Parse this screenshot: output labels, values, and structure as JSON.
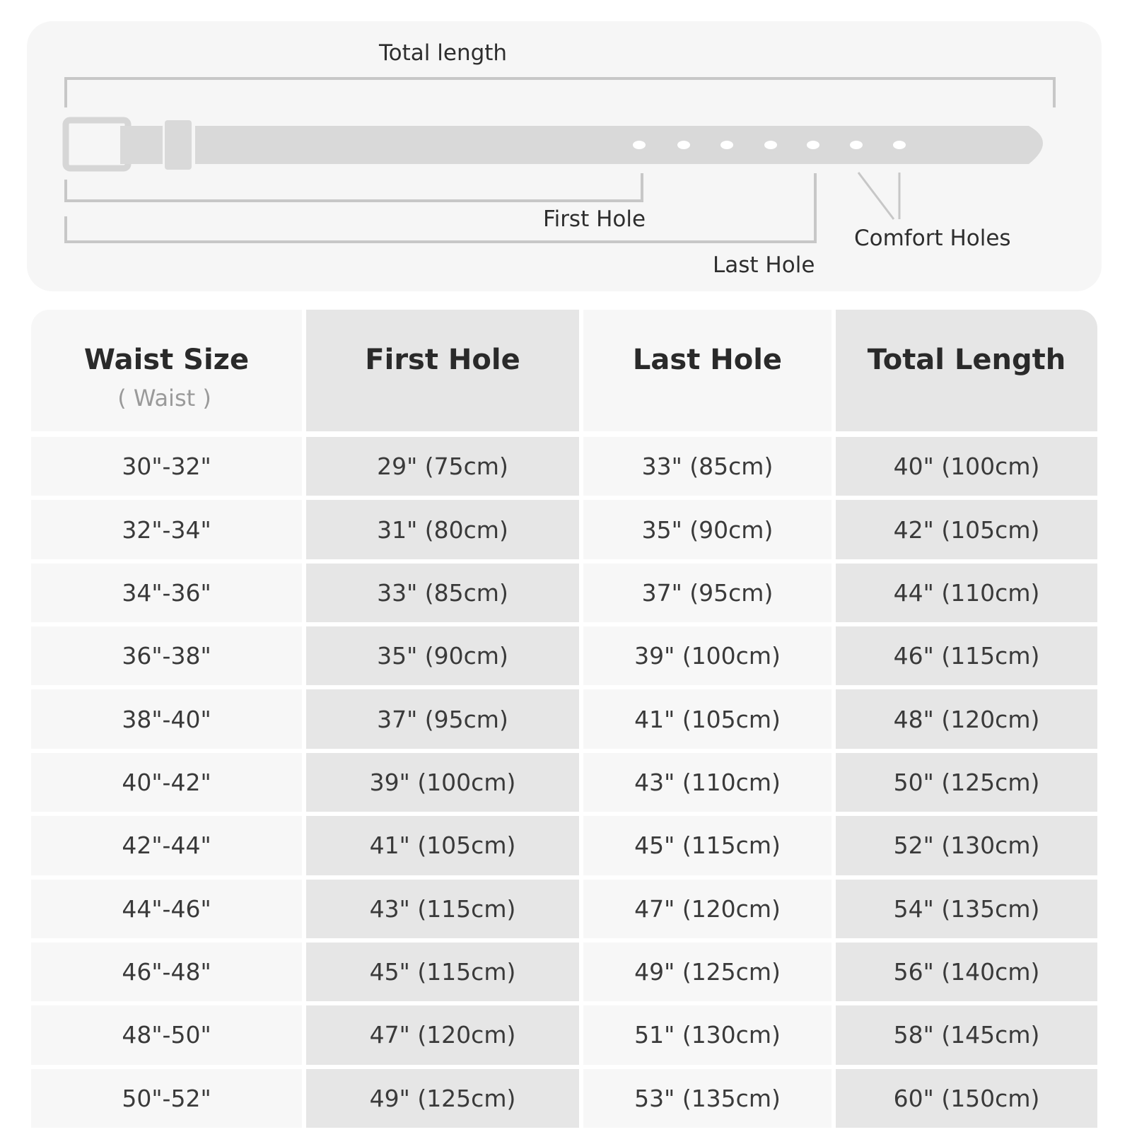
{
  "diagram": {
    "total_length_label": "Total length",
    "first_hole_label": "First Hole",
    "last_hole_label": "Last Hole",
    "comfort_holes_label": "Comfort Holes"
  },
  "table": {
    "headers": [
      {
        "title": "Waist Size",
        "subtitle": "( Waist )"
      },
      {
        "title": "First Hole"
      },
      {
        "title": "Last Hole"
      },
      {
        "title": "Total Length"
      }
    ],
    "rows": [
      [
        "30\"-32\"",
        "29\" (75cm)",
        "33\" (85cm)",
        "40\" (100cm)"
      ],
      [
        "32\"-34\"",
        "31\" (80cm)",
        "35\" (90cm)",
        "42\" (105cm)"
      ],
      [
        "34\"-36\"",
        "33\" (85cm)",
        "37\" (95cm)",
        "44\" (110cm)"
      ],
      [
        "36\"-38\"",
        "35\" (90cm)",
        "39\" (100cm)",
        "46\" (115cm)"
      ],
      [
        "38\"-40\"",
        "37\" (95cm)",
        "41\" (105cm)",
        "48\" (120cm)"
      ],
      [
        "40\"-42\"",
        "39\" (100cm)",
        "43\" (110cm)",
        "50\" (125cm)"
      ],
      [
        "42\"-44\"",
        "41\" (105cm)",
        "45\" (115cm)",
        "52\" (130cm)"
      ],
      [
        "44\"-46\"",
        "43\" (115cm)",
        "47\" (120cm)",
        "54\" (135cm)"
      ],
      [
        "46\"-48\"",
        "45\" (115cm)",
        "49\" (125cm)",
        "56\" (140cm)"
      ],
      [
        "48\"-50\"",
        "47\" (120cm)",
        "51\" (130cm)",
        "58\" (145cm)"
      ],
      [
        "50\"-52\"",
        "49\" (125cm)",
        "53\" (135cm)",
        "60\" (150cm)"
      ]
    ]
  },
  "colors": {
    "panel_background": "#f6f6f6",
    "belt": "#d9d9d9",
    "bracket": "#c7c7c7",
    "column_light": "#f7f7f7",
    "column_dark": "#e6e6e6",
    "text": "#2b2b2b",
    "subtitle_text": "#9a9a9a"
  }
}
